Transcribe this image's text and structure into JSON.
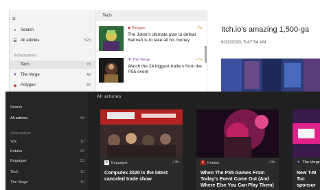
{
  "light": {
    "sidebar": {
      "search": "Search",
      "all_articles": "All articles",
      "all_count": "523",
      "section": "Subscriptions",
      "items": [
        {
          "label": "Tech",
          "count": "78"
        },
        {
          "label": "The Verge",
          "count": "48"
        },
        {
          "label": "Polygon",
          "count": "30"
        }
      ]
    },
    "list": {
      "header": "Tech",
      "items": [
        {
          "source": "Polygon",
          "time": "• 7h",
          "title": "The Joker's ultimate plan to defeat Batman is to take all his money"
        },
        {
          "source": "The Verge",
          "time": "• 7h",
          "title": "Watch the 24 biggest trailers from the PS5 event"
        }
      ]
    },
    "reader": {
      "title": "Itch.io's amazing 1,500-ga",
      "date": "6/12/2020, 5:47:54 AM"
    }
  },
  "dark": {
    "sidebar": {
      "search": "Search",
      "all_articles": "All articles",
      "all_count": "68",
      "section": "Subscriptions",
      "items": [
        {
          "label": "Vox",
          "count": "10"
        },
        {
          "label": "Kotaku",
          "count": "25"
        },
        {
          "label": "Engadget",
          "count": "23"
        },
        {
          "label": "Tech",
          "count": "10"
        },
        {
          "label": "The Verge",
          "count": "10"
        }
      ]
    },
    "header": "All articles",
    "cards": [
      {
        "source": "Engadget",
        "time": "• 3h",
        "title": "Computex 2020 is the latest canceled trade show"
      },
      {
        "source": "Kotaku",
        "time": "• 3h",
        "title": "When The PS5 Games From Today's Event Come Out (And Where Else You Can Play Them)"
      },
      {
        "source": "The Verge",
        "time": "",
        "title": "New T-M Tuc sponsor"
      }
    ]
  }
}
